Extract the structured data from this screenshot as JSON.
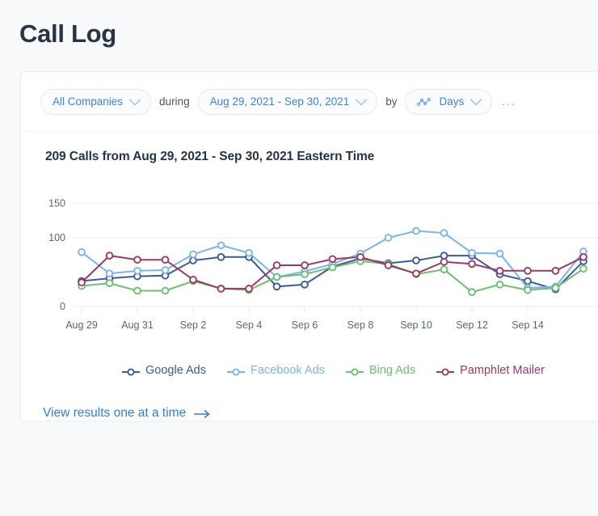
{
  "page": {
    "title": "Call Log"
  },
  "filters": {
    "company": {
      "label": "All Companies",
      "icon": "chevron-down-icon"
    },
    "conjunction_during": "during",
    "date_range": {
      "label": "Aug 29, 2021 - Sep 30, 2021",
      "icon": "chevron-down-icon"
    },
    "conjunction_by": "by",
    "granularity": {
      "label": "Days",
      "icon": "line-chart-icon"
    },
    "more": "..."
  },
  "footer": {
    "link_label": "View results one at a time",
    "arrow_icon": "arrow-right-icon"
  },
  "colors": {
    "accent_blue": "#2f7de1",
    "pill_blue": "#3b82e8",
    "google_ads": "#3b5b99",
    "facebook_ads": "#7cb5ec",
    "bing_ads": "#6dc06d",
    "pamphlet_mailer": "#9e3963",
    "grid": "#f1f3f6",
    "axis_text": "#5a6676"
  },
  "chart_data": {
    "type": "line",
    "title": "209 Calls from Aug 29, 2021 - Sep 30, 2021 Eastern Time",
    "xlabel": "",
    "ylabel": "",
    "ylim": [
      0,
      150
    ],
    "yticks": [
      0,
      100,
      150
    ],
    "ytick_labels": [
      "0",
      "100",
      "150"
    ],
    "grid": true,
    "legend_position": "bottom",
    "x": [
      "Aug 29",
      "Aug 30",
      "Aug 31",
      "Sep 1",
      "Sep 2",
      "Sep 3",
      "Sep 4",
      "Sep 5",
      "Sep 6",
      "Sep 7",
      "Sep 8",
      "Sep 9",
      "Sep 10",
      "Sep 11",
      "Sep 12",
      "Sep 13",
      "Sep 14",
      "Sep 15",
      "Sep 16"
    ],
    "xtick_labels": [
      "Aug 29",
      "Aug 31",
      "Sep 2",
      "Sep 4",
      "Sep 6",
      "Sep 8",
      "Sep 10",
      "Sep 12",
      "Sep 14"
    ],
    "series": [
      {
        "name": "Google Ads",
        "color": "#3b5b99",
        "values": [
          37,
          41,
          44,
          45,
          67,
          72,
          72,
          29,
          32,
          58,
          70,
          63,
          67,
          74,
          74,
          47,
          37,
          25,
          66
        ]
      },
      {
        "name": "Facebook Ads",
        "color": "#7cb5ec",
        "values": [
          79,
          48,
          52,
          53,
          76,
          89,
          78,
          43,
          51,
          62,
          77,
          100,
          110,
          107,
          78,
          77,
          27,
          29,
          80
        ]
      },
      {
        "name": "Bing Ads",
        "color": "#6dc06d",
        "values": [
          30,
          34,
          23,
          23,
          37,
          26,
          24,
          43,
          47,
          57,
          66,
          62,
          47,
          54,
          21,
          32,
          24,
          27,
          55
        ]
      },
      {
        "name": "Pamphlet Mailer",
        "color": "#9e3963",
        "values": [
          35,
          74,
          68,
          68,
          39,
          26,
          26,
          60,
          60,
          69,
          72,
          60,
          48,
          65,
          62,
          52,
          52,
          52,
          72
        ]
      }
    ]
  }
}
